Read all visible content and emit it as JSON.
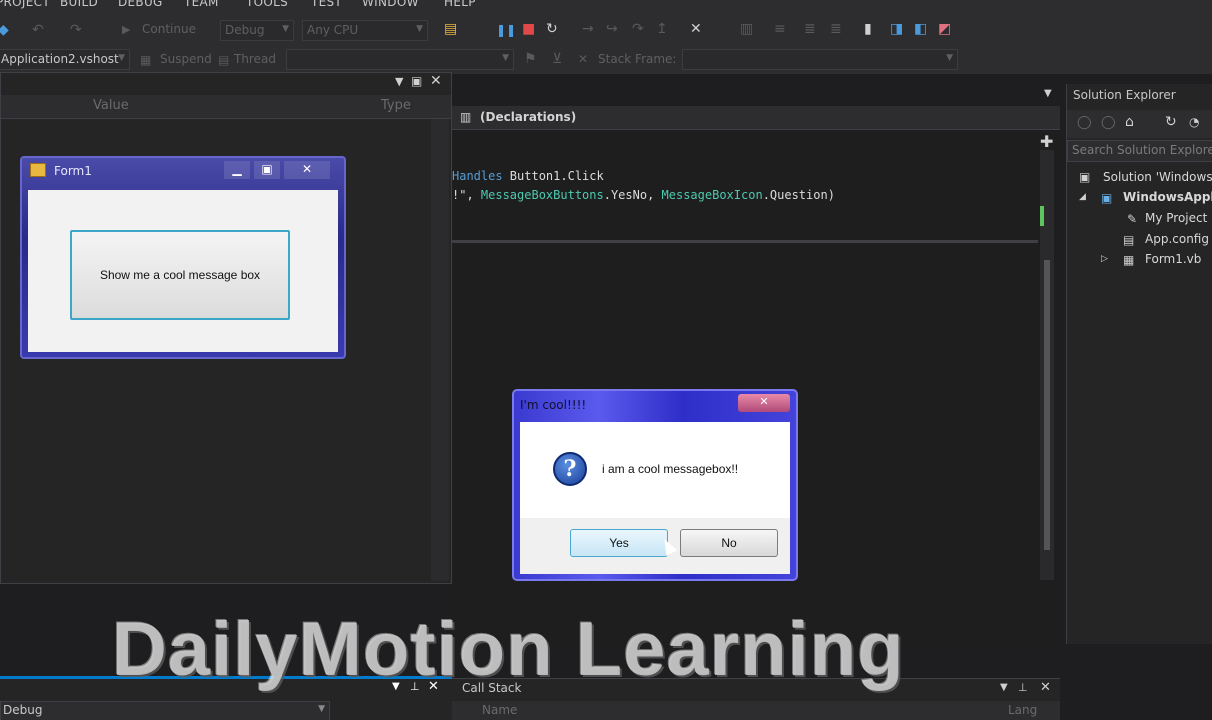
{
  "menu": {
    "items": [
      "PROJECT",
      "BUILD",
      "DEBUG",
      "TEAM",
      "TOOLS",
      "TEST",
      "WINDOW",
      "HELP"
    ]
  },
  "toolbar": {
    "continue_label": "Continue",
    "config_value": "Debug",
    "platform_value": "Any CPU",
    "process_value": "Application2.vshost",
    "suspend_label": "Suspend",
    "thread_label": "Thread",
    "stack_frame_label": "Stack Frame:"
  },
  "watch_panel": {
    "columns": [
      "Value",
      "Type"
    ]
  },
  "form1": {
    "title": "Form1",
    "button_label": "Show me a cool message box"
  },
  "editor": {
    "member_dropdown": "(Declarations)",
    "code_line_1": {
      "kw": "Handles",
      "rest": " Button1.Click"
    },
    "code_line_2": {
      "pre": "!\", ",
      "t1": "MessageBoxButtons",
      "m1": ".YesNo, ",
      "t2": "MessageBoxIcon",
      "m2": ".Question)"
    }
  },
  "solution_explorer": {
    "title": "Solution Explorer",
    "search_placeholder": "Search Solution Explorer",
    "items": [
      "Solution 'Windows",
      "WindowsAppl",
      "My Project",
      "App.config",
      "Form1.vb"
    ]
  },
  "message_box": {
    "title": "I'm cool!!!!",
    "text": "i am a cool messagebox!!",
    "yes_label": "Yes",
    "no_label": "No"
  },
  "bottom": {
    "left_dropdown": "Debug",
    "call_stack_title": "Call Stack",
    "columns": [
      "Name",
      "Lang"
    ]
  },
  "watermark": "DailyMotion Learning",
  "colors": {
    "accent": "#007acc",
    "background": "#1e1e20",
    "form_caption": "#2a2a8a"
  }
}
